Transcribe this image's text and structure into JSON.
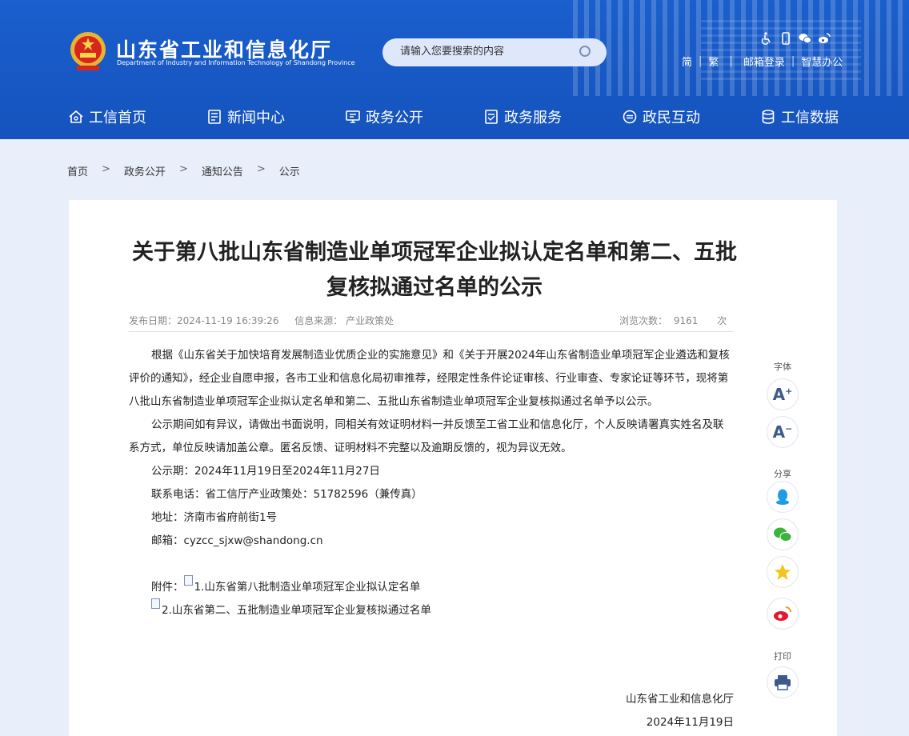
{
  "header": {
    "site_name": "山东省工业和信息化厅",
    "site_name_en": "Department of Industry and Information Technology of Shandong Province",
    "search_placeholder": "请输入您要搜索的内容",
    "utility_icons": [
      "accessibility-icon",
      "mobile-icon",
      "wechat-icon",
      "weibo-icon"
    ],
    "links": [
      "简",
      "繁",
      "邮箱登录",
      "智慧办公"
    ]
  },
  "nav": [
    {
      "label": "工信首页",
      "icon": "home-icon"
    },
    {
      "label": "新闻中心",
      "icon": "news-icon"
    },
    {
      "label": "政务公开",
      "icon": "gov-open-icon"
    },
    {
      "label": "政务服务",
      "icon": "service-icon"
    },
    {
      "label": "政民互动",
      "icon": "interaction-icon"
    },
    {
      "label": "工信数据",
      "icon": "database-icon"
    }
  ],
  "breadcrumb": [
    "首页",
    "政务公开",
    "通知公告",
    "公示"
  ],
  "article": {
    "title": "关于第八批山东省制造业单项冠军企业拟认定名单和第二、五批复核拟通过名单的公示",
    "date": "发布日期：2024-11-19 16:39:26",
    "source": "信息来源： 产业政策处",
    "views_label": "浏览次数：",
    "views": "9161",
    "views_unit": "次",
    "para1": "根据《山东省关于加快培育发展制造业优质企业的实施意见》和《关于开展2024年山东省制造业单项冠军企业遴选和复核评价的通知》，经企业自愿申报，各市工业和信息化局初审推荐，经限定性条件论证审核、行业审查、专家论证等环节，现将第八批山东省制造业单项冠军企业拟认定名单和第二、五批山东省制造业单项冠军企业复核拟通过名单予以公示。",
    "para2": "公示期间如有异议，请做出书面说明，同相关有效证明材料一并反馈至工省工业和信息化厅，个人反映请署真实姓名及联系方式，单位反映请加盖公章。匿名反馈、证明材料不完整以及逾期反馈的，视为异议无效。",
    "period": "公示期：2024年11月19日至2024年11月27日",
    "phone": "联系电话：省工信厅产业政策处：51782596（兼传真）",
    "address": "地址：济南市省府前街1号",
    "email": "邮箱：cyzcc_sjxw@shandong.cn",
    "attach_label": "附件：",
    "attach1": "1.山东省第八批制造业单项冠军企业拟认定名单",
    "attach2": "2.山东省第二、五批制造业单项冠军企业复核拟通过名单",
    "signature": "山东省工业和信息化厅",
    "sign_date": "2024年11月19日"
  },
  "side_tools": {
    "font_label": "字体",
    "share_label": "分享",
    "print_label": "打印",
    "icons": [
      "font-increase-icon",
      "font-decrease-icon",
      "qq-icon",
      "wechat-icon",
      "qzone-icon",
      "weibo-icon",
      "print-icon"
    ]
  },
  "colors": {
    "header_blue": "#1659c6",
    "page_bg": "#e8eefa"
  }
}
